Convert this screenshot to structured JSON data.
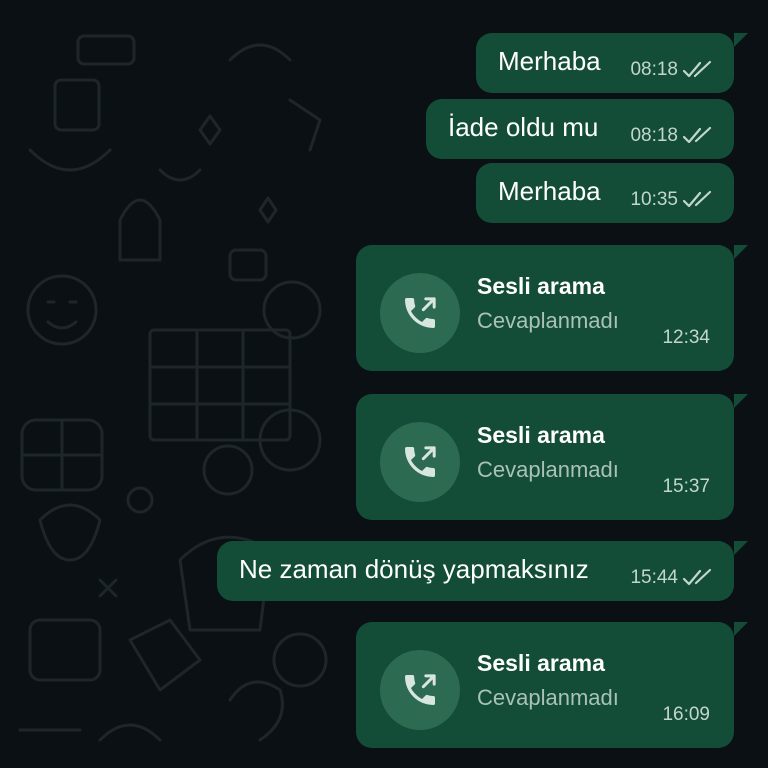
{
  "messages": [
    {
      "type": "text",
      "text": "Merhaba",
      "time": "08:18",
      "read": true
    },
    {
      "type": "text",
      "text": "İade oldu mu",
      "time": "08:18",
      "read": true
    },
    {
      "type": "text",
      "text": "Merhaba",
      "time": "10:35",
      "read": true
    },
    {
      "type": "call",
      "title": "Sesli arama",
      "status": "Cevaplanmadı",
      "time": "12:34",
      "icon": "outgoing-call-icon"
    },
    {
      "type": "call",
      "title": "Sesli arama",
      "status": "Cevaplanmadı",
      "time": "15:37",
      "icon": "outgoing-call-icon"
    },
    {
      "type": "text",
      "text": "Ne zaman dönüş yapmaksınız",
      "time": "15:44",
      "read": true
    },
    {
      "type": "call",
      "title": "Sesli arama",
      "status": "Cevaplanmadı",
      "time": "16:09",
      "icon": "outgoing-call-icon"
    }
  ],
  "colors": {
    "background": "#0b1014",
    "bubble": "#134d37",
    "call_icon_bg": "#2d6a52",
    "read_ticks": "#c3d6cd"
  }
}
